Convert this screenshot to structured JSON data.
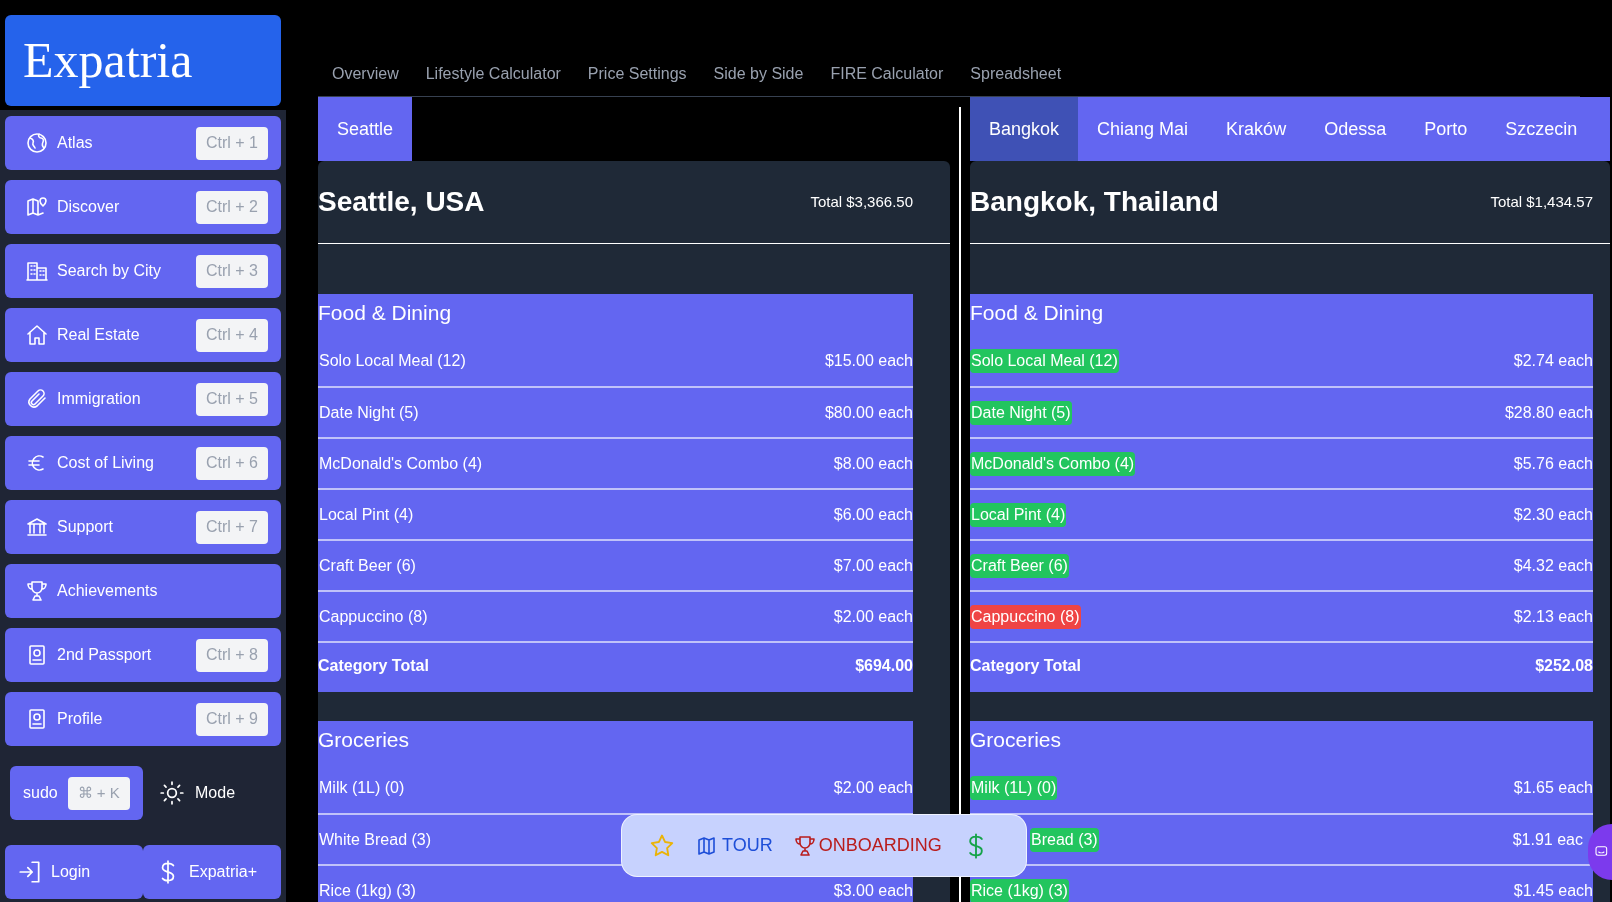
{
  "brand": "Expatria",
  "sidebar": {
    "items": [
      {
        "label": "Atlas",
        "shortcut": "Ctrl + 1"
      },
      {
        "label": "Discover",
        "shortcut": "Ctrl + 2"
      },
      {
        "label": "Search by City",
        "shortcut": "Ctrl + 3"
      },
      {
        "label": "Real Estate",
        "shortcut": "Ctrl + 4"
      },
      {
        "label": "Immigration",
        "shortcut": "Ctrl + 5"
      },
      {
        "label": "Cost of Living",
        "shortcut": "Ctrl + 6"
      },
      {
        "label": "Support",
        "shortcut": "Ctrl + 7"
      },
      {
        "label": "Achievements"
      },
      {
        "label": "2nd Passport",
        "shortcut": "Ctrl + 8"
      },
      {
        "label": "Profile",
        "shortcut": "Ctrl + 9"
      }
    ],
    "sudo": {
      "label": "sudo",
      "shortcut": "⌘ + K"
    },
    "mode": {
      "label": "Mode"
    },
    "account_buttons": [
      "Login",
      "Expatria+"
    ]
  },
  "top_tabs": [
    {
      "label": "Overview",
      "selected": false
    },
    {
      "label": "Lifestyle Calculator",
      "selected": false
    },
    {
      "label": "Price Settings",
      "selected": false
    },
    {
      "label": "Side by Side",
      "selected": false
    },
    {
      "label": "FIRE Calculator",
      "selected": false
    },
    {
      "label": "Spreadsheet",
      "selected": false
    }
  ],
  "panels": [
    {
      "tabs": [
        {
          "label": "Seattle",
          "selected": false
        }
      ],
      "title": "Seattle, USA",
      "total": "Total $3,366.50",
      "categories": [
        {
          "name": "Food & Dining",
          "items": [
            {
              "label": "Solo Local Meal (12)",
              "price": "$15.00 each"
            },
            {
              "label": "Date Night (5)",
              "price": "$80.00 each"
            },
            {
              "label": "McDonald's Combo (4)",
              "price": "$8.00 each"
            },
            {
              "label": "Local Pint (4)",
              "price": "$6.00 each"
            },
            {
              "label": "Craft Beer (6)",
              "price": "$7.00 each"
            },
            {
              "label": "Cappuccino (8)",
              "price": "$2.00 each"
            }
          ],
          "total_label": "Category Total",
          "total": "$694.00"
        },
        {
          "name": "Groceries",
          "items": [
            {
              "label": "Milk (1L) (0)",
              "price": "$2.00 each"
            },
            {
              "label": "White Bread (3)"
            },
            {
              "label": "Rice (1kg) (3)",
              "price": "$3.00 each"
            }
          ]
        }
      ]
    },
    {
      "tabs": [
        {
          "label": "Bangkok",
          "selected": true
        },
        {
          "label": "Chiang Mai",
          "selected": false
        },
        {
          "label": "Kraków",
          "selected": false
        },
        {
          "label": "Odessa",
          "selected": false
        },
        {
          "label": "Porto",
          "selected": false
        },
        {
          "label": "Szczecin",
          "selected": false
        }
      ],
      "title": "Bangkok, Thailand",
      "total": "Total $1,434.57",
      "categories": [
        {
          "name": "Food & Dining",
          "items": [
            {
              "label": "Solo Local Meal (12)",
              "price": "$2.74 each",
              "color": "#22c55e"
            },
            {
              "label": "Date Night (5)",
              "price": "$28.80 each",
              "color": "#22c55e"
            },
            {
              "label": "McDonald's Combo (4)",
              "price": "$5.76 each",
              "color": "#22c55e"
            },
            {
              "label": "Local Pint (4)",
              "price": "$2.30 each",
              "color": "#22c55e"
            },
            {
              "label": "Craft Beer (6)",
              "price": "$4.32 each",
              "color": "#22c55e"
            },
            {
              "label": "Cappuccino (8)",
              "price": "$2.13 each",
              "color": "#ef4444"
            }
          ],
          "total_label": "Category Total",
          "total": "$252.08"
        },
        {
          "name": "Groceries",
          "items": [
            {
              "label": "Milk (1L) (0)",
              "price": "$1.65 each",
              "color": "#22c55e"
            },
            {
              "label": "Bread (3)",
              "price": "$1.91 eac",
              "color": "#22c55e"
            },
            {
              "label": "Rice (1kg) (3)",
              "price": "$1.45 each",
              "color": "#22c55e"
            }
          ]
        }
      ]
    }
  ],
  "tour_bar": [
    {
      "kind": "star"
    },
    {
      "kind": "tour",
      "label": "TOUR"
    },
    {
      "kind": "onboarding",
      "label": "ONBOARDING"
    },
    {
      "kind": "dollar"
    }
  ]
}
